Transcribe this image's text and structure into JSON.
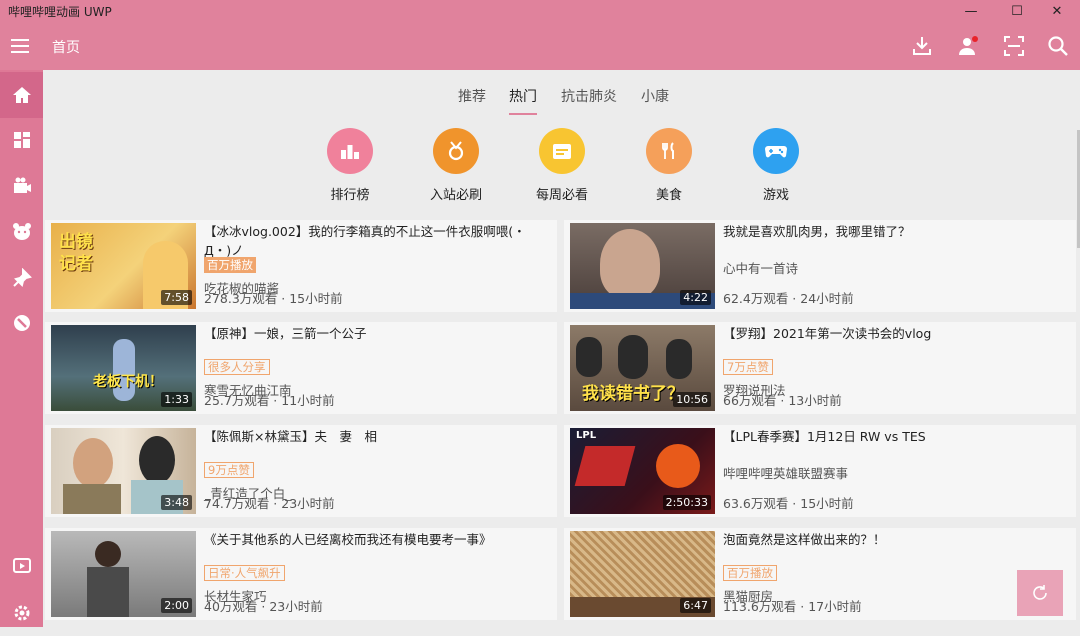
{
  "window": {
    "title": "哔哩哔哩动画 UWP",
    "minimize": "—",
    "maximize": "☐",
    "close": "✕"
  },
  "header": {
    "page_title": "首页",
    "icons": [
      "download-icon",
      "user-icon",
      "scan-icon",
      "search-icon"
    ],
    "accent": "#e0829c"
  },
  "sidebar": {
    "items": [
      "home-icon",
      "category-icon",
      "live-icon",
      "anime-icon",
      "bangumi-icon",
      "topic-icon"
    ],
    "bottom": [
      "live-tv-icon",
      "settings-icon"
    ]
  },
  "tabs": {
    "items": [
      "推荐",
      "热门",
      "抗击肺炎",
      "小康"
    ],
    "active": "热门"
  },
  "quick": [
    {
      "label": "排行榜",
      "color": "#f0819b",
      "icon": "ranking-icon"
    },
    {
      "label": "入站必刷",
      "color": "#f0942c",
      "icon": "medal-icon"
    },
    {
      "label": "每周必看",
      "color": "#f8c531",
      "icon": "calendar-icon"
    },
    {
      "label": "美食",
      "color": "#f5a05a",
      "icon": "fork-knife-icon"
    },
    {
      "label": "游戏",
      "color": "#2ea1f0",
      "icon": "gamepad-icon"
    }
  ],
  "videos": [
    {
      "title": "【冰冰vlog.002】我的行李箱真的不止这一件衣服啊喂(・Д・)ノ",
      "tag": "百万播放",
      "tag_style": "filled",
      "author": "吃花椒的喵酱",
      "meta": "278.3万观看 · 15小时前",
      "duration": "7:58",
      "overlay": "出镜记者",
      "thumb": "#e0a040"
    },
    {
      "title": "我就是喜欢肌肉男，我哪里错了？",
      "tag": "",
      "tag_style": "",
      "author": "心中有一首诗",
      "meta": "62.4万观看 · 24小时前",
      "duration": "4:22",
      "overlay": "",
      "thumb": "#6a5a52"
    },
    {
      "title": "【原神】一娘，三箭一个公子",
      "tag": "很多人分享",
      "tag_style": "outlined",
      "author": "寒雪无忆曲江南",
      "meta": "25.7万观看 · 11小时前",
      "duration": "1:33",
      "overlay": "老板下机！",
      "thumb": "#3c4f5a"
    },
    {
      "title": "【罗翔】2021年第一次读书会的vlog",
      "tag": "7万点赞",
      "tag_style": "outlined",
      "author": "罗翔说刑法",
      "meta": "66万观看 · 13小时前",
      "duration": "10:56",
      "overlay": "我读错书了？",
      "thumb": "#6b5a4a"
    },
    {
      "title": "【陈佩斯×林黛玉】夫　妻　相",
      "tag": "9万点赞",
      "tag_style": "outlined",
      "author": "_青红造了个白_",
      "meta": "74.7万观看 · 23小时前",
      "duration": "3:48",
      "overlay": "",
      "thumb": "#cfc2b0"
    },
    {
      "title": "【LPL春季赛】1月12日 RW vs TES",
      "tag": "",
      "tag_style": "",
      "author": "哔哩哔哩英雄联盟赛事",
      "meta": "63.6万观看 · 15小时前",
      "duration": "2:50:33",
      "overlay": "LPL",
      "thumb": "#1c1f33"
    },
    {
      "title": "《关于其他系的人已经离校而我还有模电要考一事》",
      "tag": "日常·人气飙升",
      "tag_style": "outlined",
      "author": "长材生家巧",
      "meta": "40万观看 · 23小时前",
      "duration": "2:00",
      "overlay": "",
      "thumb": "#8a8a8a"
    },
    {
      "title": "泡面竟然是这样做出来的？！",
      "tag": "百万播放",
      "tag_style": "outlined",
      "author": "黑猫厨房",
      "meta": "113.6万观看 · 17小时前",
      "duration": "6:47",
      "overlay": "",
      "thumb": "#b89060"
    }
  ]
}
